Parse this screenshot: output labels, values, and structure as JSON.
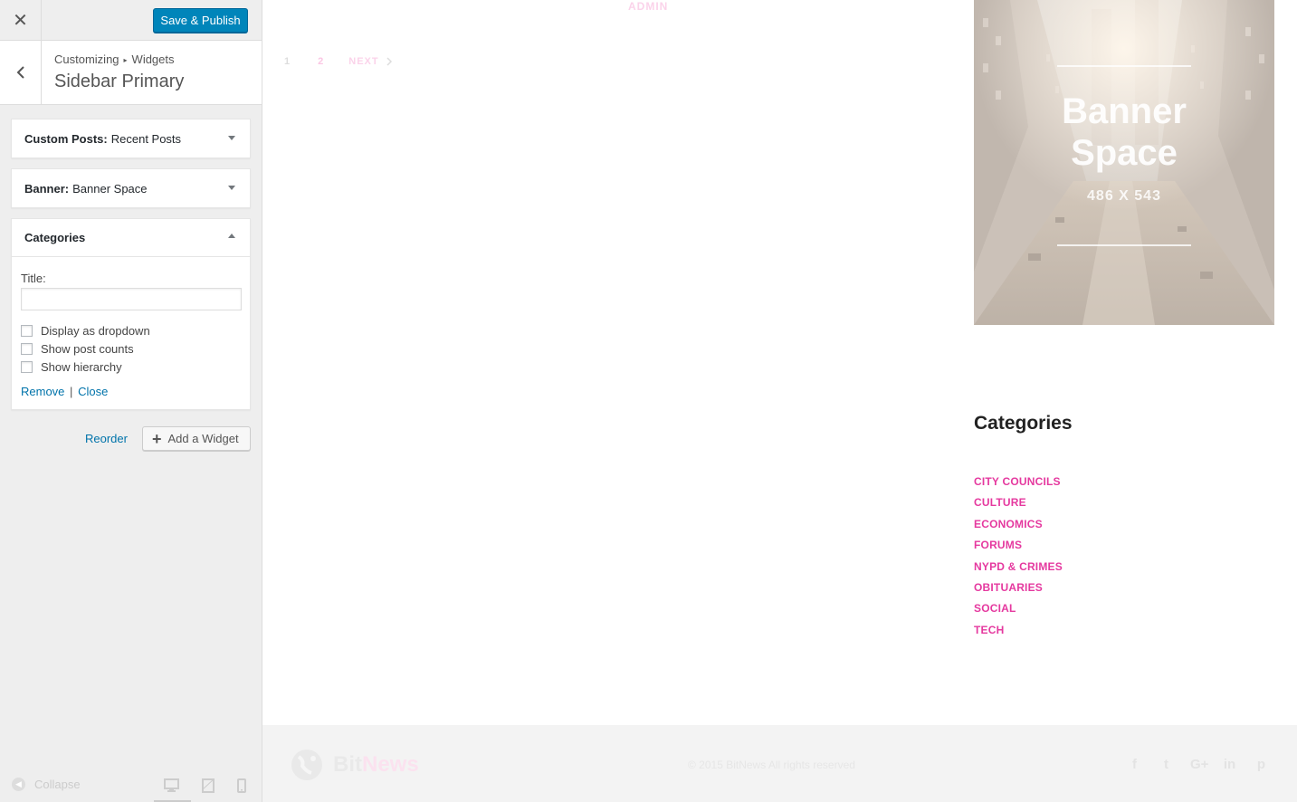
{
  "customizer": {
    "close_icon": "close-icon",
    "publish_label": "Save & Publish",
    "breadcrumb": {
      "parent": "Customizing",
      "separator": "▸",
      "current": "Widgets"
    },
    "section_title": "Sidebar Primary",
    "widgets": [
      {
        "type": "Custom Posts:",
        "title": "Recent Posts",
        "state": "collapsed"
      },
      {
        "type": "Banner:",
        "title": "Banner Space",
        "state": "collapsed"
      },
      {
        "type": "Categories",
        "title": "",
        "state": "expanded"
      }
    ],
    "categories_form": {
      "title_label": "Title:",
      "title_value": "",
      "options": [
        {
          "label": "Display as dropdown",
          "checked": false
        },
        {
          "label": "Show post counts",
          "checked": false
        },
        {
          "label": "Show hierarchy",
          "checked": false
        }
      ],
      "remove_label": "Remove",
      "link_separator": "|",
      "close_label": "Close"
    },
    "reorder_label": "Reorder",
    "add_widget_label": "Add a Widget",
    "collapse_label": "Collapse",
    "devices": [
      "desktop",
      "tablet",
      "mobile"
    ],
    "accent_color": "#0085ba"
  },
  "preview": {
    "admin_label": "ADMIN",
    "pagination": {
      "pages": [
        "1",
        "2"
      ],
      "next_label": "NEXT"
    },
    "banner": {
      "title_line1": "Banner",
      "title_line2": "Space",
      "size_label": "486 X 543"
    },
    "categories_heading": "Categories",
    "categories": [
      "CITY COUNCILS",
      "CULTURE",
      "ECONOMICS",
      "FORUMS",
      "NYPD & CRIMES",
      "OBITUARIES",
      "SOCIAL",
      "TECH"
    ],
    "category_color": "#e5399f",
    "footer": {
      "logo_part1": "Bit",
      "logo_part2": "News",
      "copyright": "© 2015 BitNews All rights reserved",
      "social": [
        "f",
        "t",
        "G+",
        "in",
        "p"
      ]
    }
  }
}
